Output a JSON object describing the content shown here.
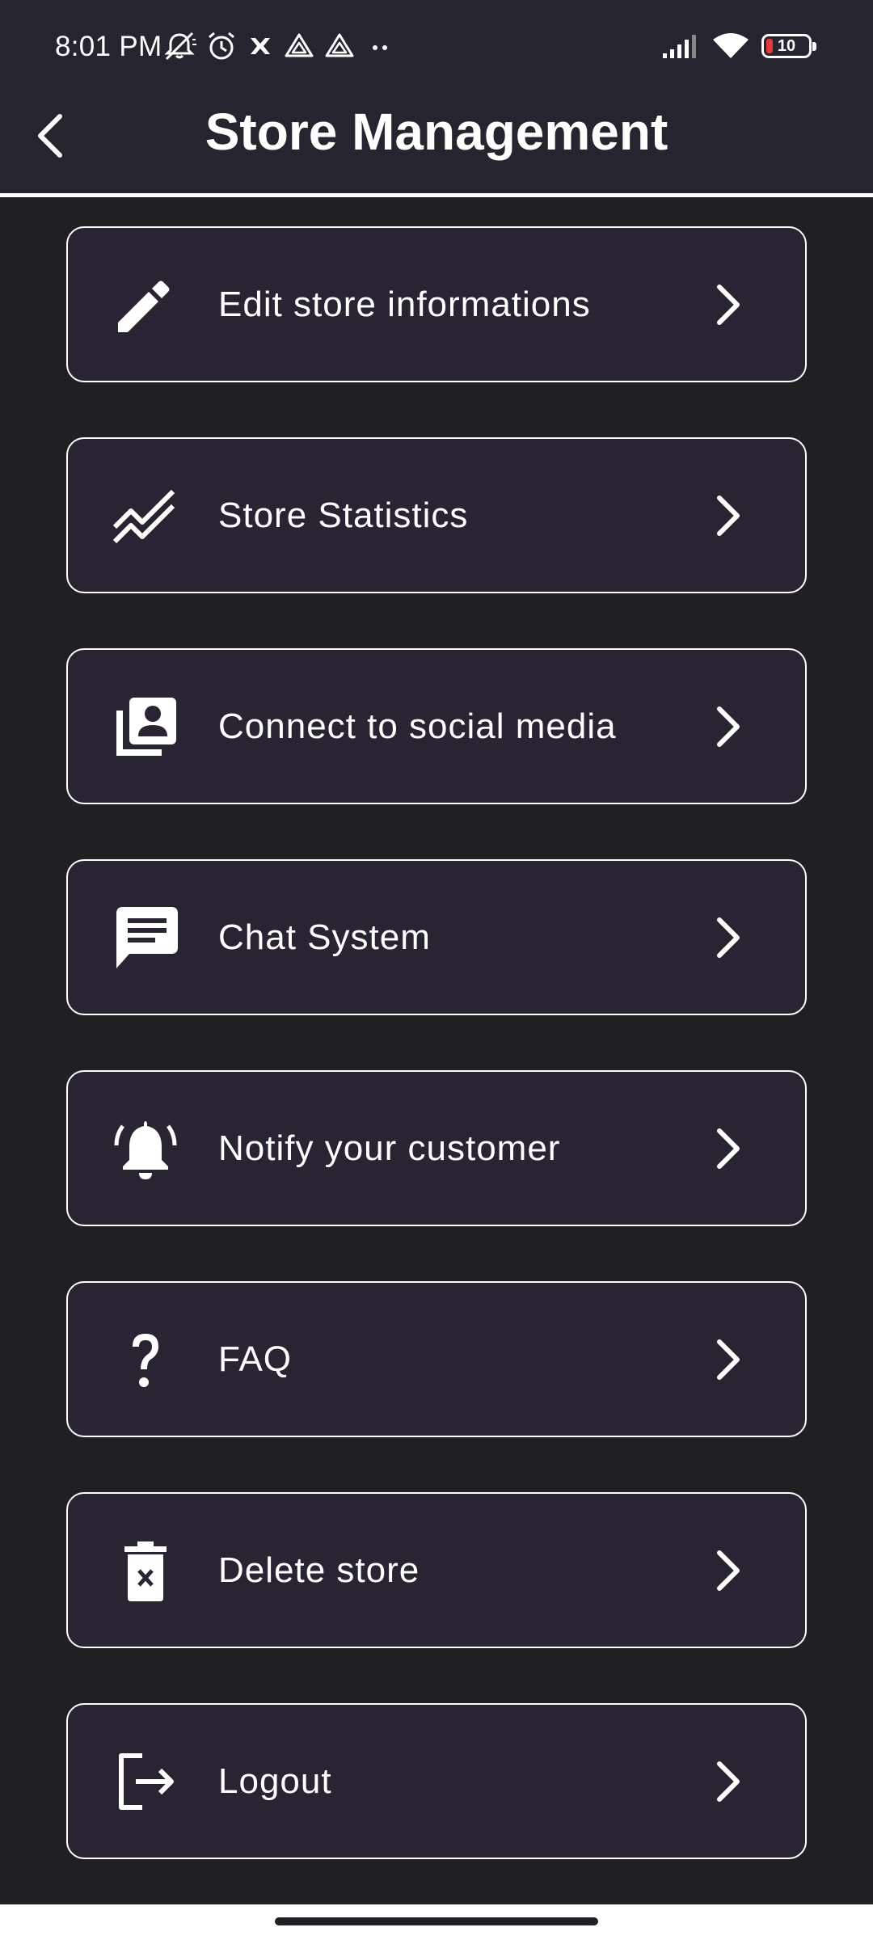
{
  "status_bar": {
    "time": "8:01 PM",
    "battery_level": "10",
    "icons_left": [
      "mute-icon",
      "alarm-icon",
      "close-app-icon",
      "drive-icon",
      "drive-icon",
      "more-dots-icon"
    ],
    "icons_right": [
      "signal-icon",
      "wifi-icon",
      "battery-icon"
    ]
  },
  "header": {
    "title": "Store Management",
    "back_icon": "back-arrow-icon"
  },
  "menu": {
    "items": [
      {
        "label": "Edit store informations",
        "icon": "pencil-icon"
      },
      {
        "label": "Store Statistics",
        "icon": "trending-icon"
      },
      {
        "label": "Connect to social media",
        "icon": "contacts-icon"
      },
      {
        "label": "Chat System",
        "icon": "chat-icon"
      },
      {
        "label": "Notify your customer",
        "icon": "bell-ringing-icon"
      },
      {
        "label": "FAQ",
        "icon": "question-icon"
      },
      {
        "label": "Delete store",
        "icon": "delete-icon"
      },
      {
        "label": "Logout",
        "icon": "logout-icon"
      }
    ]
  },
  "colors": {
    "background": "#1F1F24",
    "header_background": "#25252F",
    "card_background": "#2A2432",
    "card_border": "#FFFFFF",
    "text": "#FFFFFF",
    "battery_low": "#E33B3B"
  }
}
